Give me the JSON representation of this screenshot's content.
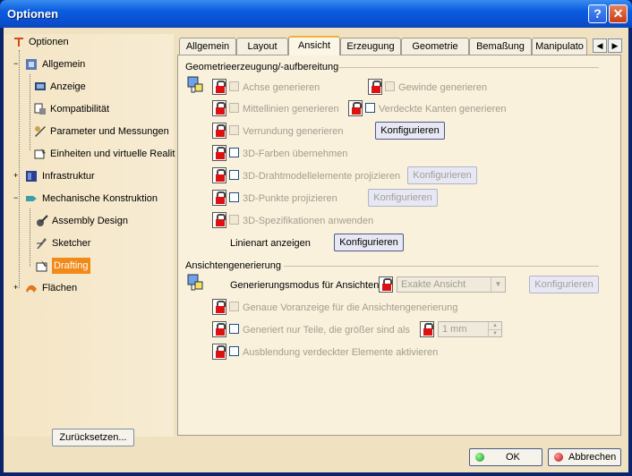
{
  "window": {
    "title": "Optionen",
    "help_label": "?",
    "close_label": "✕"
  },
  "tree": {
    "items": [
      {
        "label": "Optionen"
      },
      {
        "label": "Allgemein"
      },
      {
        "label": "Anzeige"
      },
      {
        "label": "Kompatibilität"
      },
      {
        "label": "Parameter und Messungen"
      },
      {
        "label": "Einheiten und virtuelle Realit"
      },
      {
        "label": "Infrastruktur"
      },
      {
        "label": "Mechanische Konstruktion"
      },
      {
        "label": "Assembly Design"
      },
      {
        "label": "Sketcher"
      },
      {
        "label": "Drafting"
      },
      {
        "label": "Flächen"
      }
    ],
    "reset_label": "Zurücksetzen..."
  },
  "tabs": [
    "Allgemein",
    "Layout",
    "Ansicht",
    "Erzeugung",
    "Geometrie",
    "Bemaßung",
    "Manipulato"
  ],
  "tab_scroll": {
    "left": "◀",
    "right": "▶"
  },
  "geometry": {
    "title": "Geometrieerzeugung/-aufbereitung",
    "achse": "Achse generieren",
    "gewinde": "Gewinde generieren",
    "mittellinien": "Mittellinien generieren",
    "verdeckte": "Verdeckte Kanten generieren",
    "verrundung": "Verrundung generieren",
    "konfig1": "Konfigurieren",
    "farben": "3D-Farben übernehmen",
    "draht": "3D-Drahtmodellelemente projizieren",
    "konfig2": "Konfigurieren",
    "punkte": "3D-Punkte projizieren",
    "konfig3": "Konfigurieren",
    "spez": "3D-Spezifikationen anwenden",
    "linienart": "Linienart anzeigen",
    "konfig4": "Konfigurieren"
  },
  "views": {
    "title": "Ansichtengenerierung",
    "modus_label": "Generierungsmodus für Ansichten",
    "modus_value": "Exakte Ansicht",
    "konfig": "Konfigurieren",
    "voranzeige": "Genaue Voranzeige für die Ansichtengenerierung",
    "teile": "Generiert nur Teile, die größer sind als",
    "teile_value": "1 mm",
    "ausblendung": "Ausblendung verdeckter Elemente aktivieren"
  },
  "footer": {
    "ok": "OK",
    "cancel": "Abbrechen"
  },
  "colors": {
    "title_bar": "#0a5ce0",
    "dialog_bg": "#f0e2c0",
    "selected": "#f28a1a"
  }
}
